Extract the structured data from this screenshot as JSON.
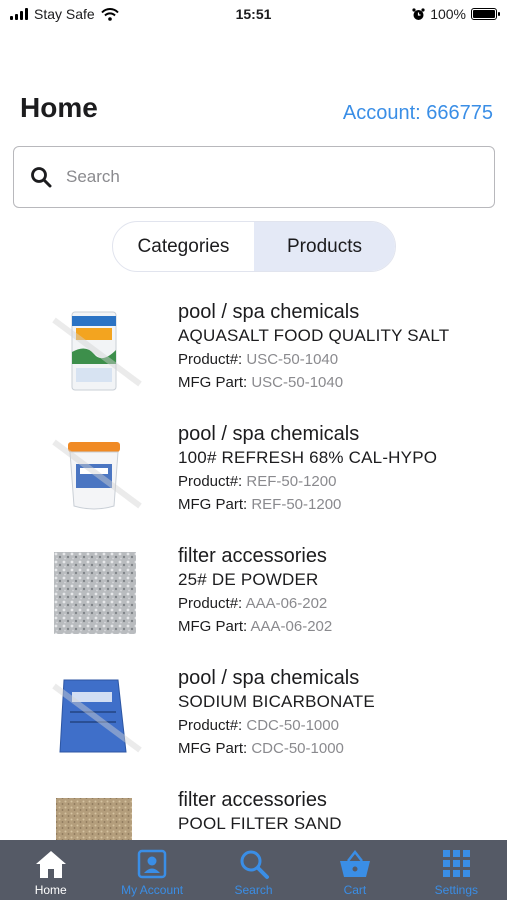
{
  "status_bar": {
    "carrier": "Stay Safe",
    "time": "15:51",
    "battery": "100%"
  },
  "header": {
    "title": "Home",
    "account_link": "Account: 666775"
  },
  "search": {
    "placeholder": "Search"
  },
  "segmented": {
    "categories_label": "Categories",
    "products_label": "Products",
    "selected": "Products"
  },
  "products": [
    {
      "category": "pool / spa chemicals",
      "name": "AQUASALT FOOD QUALITY SALT",
      "product_label": "Product#:",
      "product_no": "USC-50-1040",
      "mfg_label": "MFG Part:",
      "mfg_part": "USC-50-1040"
    },
    {
      "category": "pool / spa chemicals",
      "name": "100# REFRESH 68% CAL-HYPO",
      "product_label": "Product#:",
      "product_no": "REF-50-1200",
      "mfg_label": "MFG Part:",
      "mfg_part": "REF-50-1200"
    },
    {
      "category": "filter accessories",
      "name": "25# DE POWDER",
      "product_label": "Product#:",
      "product_no": "AAA-06-202",
      "mfg_label": "MFG Part:",
      "mfg_part": "AAA-06-202"
    },
    {
      "category": "pool / spa chemicals",
      "name": "SODIUM BICARBONATE",
      "product_label": "Product#:",
      "product_no": "CDC-50-1000",
      "mfg_label": "MFG Part:",
      "mfg_part": "CDC-50-1000"
    },
    {
      "category": "filter accessories",
      "name": "POOL FILTER SAND"
    }
  ],
  "tab_bar": {
    "home": "Home",
    "my_account": "My Account",
    "search": "Search",
    "cart": "Cart",
    "settings": "Settings",
    "active": "Home"
  },
  "colors": {
    "accent": "#3a8ee6",
    "tab_bar_bg": "#555a66",
    "segment_active_bg": "#e4e9f6"
  }
}
